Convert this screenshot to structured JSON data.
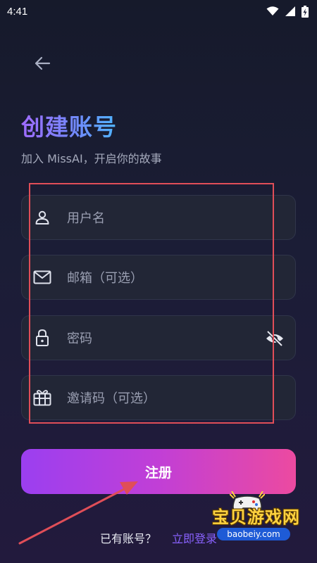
{
  "status_bar": {
    "time": "4:41",
    "icons": [
      "wifi-icon",
      "signal-icon",
      "battery-charging-icon"
    ]
  },
  "header": {
    "back_icon": "back-arrow-icon",
    "title": "创建账号",
    "subtitle": "加入 MissAI，开启你的故事"
  },
  "form": {
    "fields": [
      {
        "name": "username",
        "icon": "user-icon",
        "placeholder": "用户名"
      },
      {
        "name": "email",
        "icon": "mail-icon",
        "placeholder": "邮箱（可选）"
      },
      {
        "name": "password",
        "icon": "lock-icon",
        "placeholder": "密码",
        "trailing_icon": "eye-off-icon"
      },
      {
        "name": "invite-code",
        "icon": "gift-icon",
        "placeholder": "邀请码（可选）"
      }
    ],
    "submit_label": "注册"
  },
  "footer": {
    "login_prompt": "已有账号？",
    "login_link": "立即登录"
  },
  "watermark": {
    "text": "宝贝游戏网",
    "url": "baobeiy.com"
  },
  "colors": {
    "background": "#1b1d36",
    "field_bg": "#222636",
    "accent_purple": "#9b3ff0",
    "accent_pink": "#ec4aa0",
    "link": "#8a62ff",
    "annotation_red": "#e04e58"
  }
}
